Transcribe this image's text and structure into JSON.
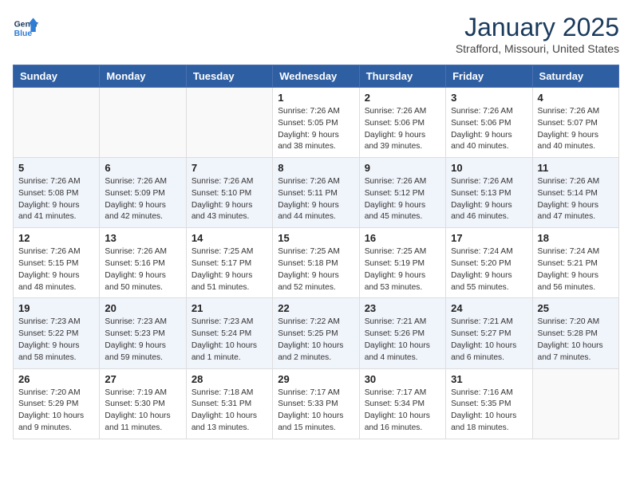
{
  "logo": {
    "line1": "General",
    "line2": "Blue"
  },
  "header": {
    "month": "January 2025",
    "location": "Strafford, Missouri, United States"
  },
  "weekdays": [
    "Sunday",
    "Monday",
    "Tuesday",
    "Wednesday",
    "Thursday",
    "Friday",
    "Saturday"
  ],
  "weeks": [
    [
      {
        "day": "",
        "info": ""
      },
      {
        "day": "",
        "info": ""
      },
      {
        "day": "",
        "info": ""
      },
      {
        "day": "1",
        "info": "Sunrise: 7:26 AM\nSunset: 5:05 PM\nDaylight: 9 hours and 38 minutes."
      },
      {
        "day": "2",
        "info": "Sunrise: 7:26 AM\nSunset: 5:06 PM\nDaylight: 9 hours and 39 minutes."
      },
      {
        "day": "3",
        "info": "Sunrise: 7:26 AM\nSunset: 5:06 PM\nDaylight: 9 hours and 40 minutes."
      },
      {
        "day": "4",
        "info": "Sunrise: 7:26 AM\nSunset: 5:07 PM\nDaylight: 9 hours and 40 minutes."
      }
    ],
    [
      {
        "day": "5",
        "info": "Sunrise: 7:26 AM\nSunset: 5:08 PM\nDaylight: 9 hours and 41 minutes."
      },
      {
        "day": "6",
        "info": "Sunrise: 7:26 AM\nSunset: 5:09 PM\nDaylight: 9 hours and 42 minutes."
      },
      {
        "day": "7",
        "info": "Sunrise: 7:26 AM\nSunset: 5:10 PM\nDaylight: 9 hours and 43 minutes."
      },
      {
        "day": "8",
        "info": "Sunrise: 7:26 AM\nSunset: 5:11 PM\nDaylight: 9 hours and 44 minutes."
      },
      {
        "day": "9",
        "info": "Sunrise: 7:26 AM\nSunset: 5:12 PM\nDaylight: 9 hours and 45 minutes."
      },
      {
        "day": "10",
        "info": "Sunrise: 7:26 AM\nSunset: 5:13 PM\nDaylight: 9 hours and 46 minutes."
      },
      {
        "day": "11",
        "info": "Sunrise: 7:26 AM\nSunset: 5:14 PM\nDaylight: 9 hours and 47 minutes."
      }
    ],
    [
      {
        "day": "12",
        "info": "Sunrise: 7:26 AM\nSunset: 5:15 PM\nDaylight: 9 hours and 48 minutes."
      },
      {
        "day": "13",
        "info": "Sunrise: 7:26 AM\nSunset: 5:16 PM\nDaylight: 9 hours and 50 minutes."
      },
      {
        "day": "14",
        "info": "Sunrise: 7:25 AM\nSunset: 5:17 PM\nDaylight: 9 hours and 51 minutes."
      },
      {
        "day": "15",
        "info": "Sunrise: 7:25 AM\nSunset: 5:18 PM\nDaylight: 9 hours and 52 minutes."
      },
      {
        "day": "16",
        "info": "Sunrise: 7:25 AM\nSunset: 5:19 PM\nDaylight: 9 hours and 53 minutes."
      },
      {
        "day": "17",
        "info": "Sunrise: 7:24 AM\nSunset: 5:20 PM\nDaylight: 9 hours and 55 minutes."
      },
      {
        "day": "18",
        "info": "Sunrise: 7:24 AM\nSunset: 5:21 PM\nDaylight: 9 hours and 56 minutes."
      }
    ],
    [
      {
        "day": "19",
        "info": "Sunrise: 7:23 AM\nSunset: 5:22 PM\nDaylight: 9 hours and 58 minutes."
      },
      {
        "day": "20",
        "info": "Sunrise: 7:23 AM\nSunset: 5:23 PM\nDaylight: 9 hours and 59 minutes."
      },
      {
        "day": "21",
        "info": "Sunrise: 7:23 AM\nSunset: 5:24 PM\nDaylight: 10 hours and 1 minute."
      },
      {
        "day": "22",
        "info": "Sunrise: 7:22 AM\nSunset: 5:25 PM\nDaylight: 10 hours and 2 minutes."
      },
      {
        "day": "23",
        "info": "Sunrise: 7:21 AM\nSunset: 5:26 PM\nDaylight: 10 hours and 4 minutes."
      },
      {
        "day": "24",
        "info": "Sunrise: 7:21 AM\nSunset: 5:27 PM\nDaylight: 10 hours and 6 minutes."
      },
      {
        "day": "25",
        "info": "Sunrise: 7:20 AM\nSunset: 5:28 PM\nDaylight: 10 hours and 7 minutes."
      }
    ],
    [
      {
        "day": "26",
        "info": "Sunrise: 7:20 AM\nSunset: 5:29 PM\nDaylight: 10 hours and 9 minutes."
      },
      {
        "day": "27",
        "info": "Sunrise: 7:19 AM\nSunset: 5:30 PM\nDaylight: 10 hours and 11 minutes."
      },
      {
        "day": "28",
        "info": "Sunrise: 7:18 AM\nSunset: 5:31 PM\nDaylight: 10 hours and 13 minutes."
      },
      {
        "day": "29",
        "info": "Sunrise: 7:17 AM\nSunset: 5:33 PM\nDaylight: 10 hours and 15 minutes."
      },
      {
        "day": "30",
        "info": "Sunrise: 7:17 AM\nSunset: 5:34 PM\nDaylight: 10 hours and 16 minutes."
      },
      {
        "day": "31",
        "info": "Sunrise: 7:16 AM\nSunset: 5:35 PM\nDaylight: 10 hours and 18 minutes."
      },
      {
        "day": "",
        "info": ""
      }
    ]
  ]
}
